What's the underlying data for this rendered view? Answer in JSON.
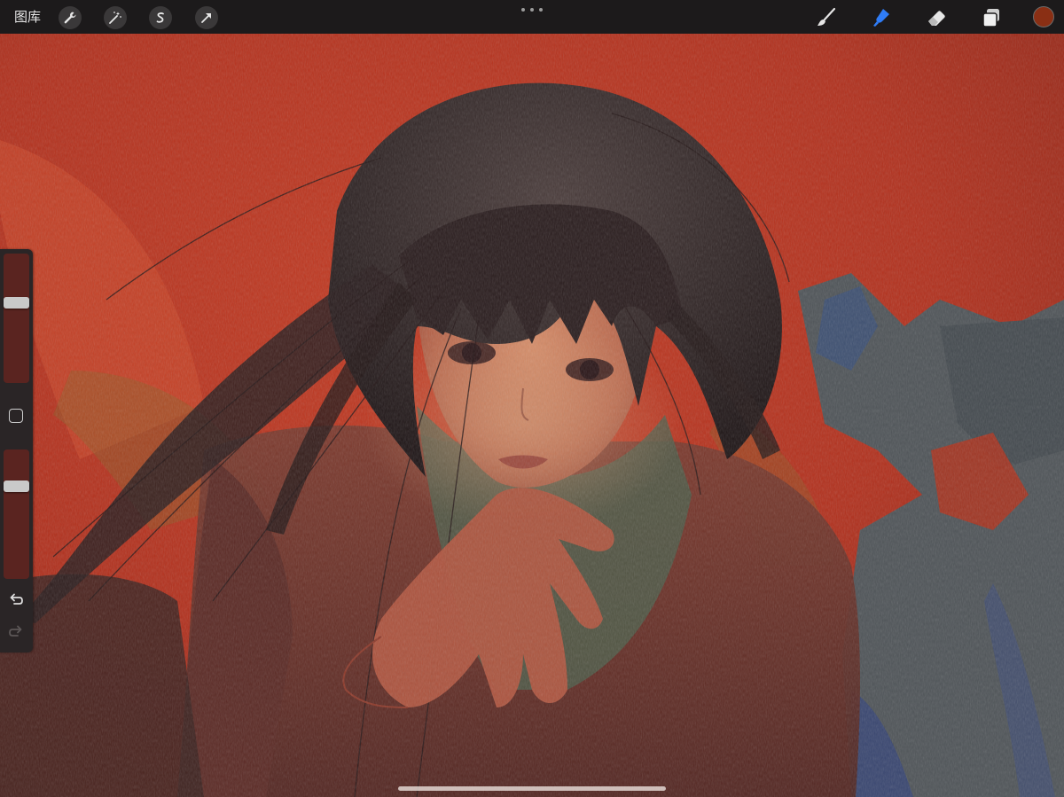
{
  "app": {
    "gallery_label": "图库"
  },
  "topbar": {
    "left_tools": [
      {
        "icon": "wrench-icon",
        "name": "actions"
      },
      {
        "icon": "magic-wand-icon",
        "name": "adjustments"
      },
      {
        "icon": "selection-s-icon",
        "name": "selection"
      },
      {
        "icon": "arrow-cursor-icon",
        "name": "transform"
      }
    ],
    "right_tools": [
      {
        "icon": "brush-icon",
        "name": "paint",
        "active": false
      },
      {
        "icon": "smudge-icon",
        "name": "smudge",
        "active": true
      },
      {
        "icon": "eraser-icon",
        "name": "erase",
        "active": false
      },
      {
        "icon": "layers-icon",
        "name": "layers",
        "active": false
      }
    ],
    "current_color": "#8a2f14",
    "accent_color": "#2f7cf6"
  },
  "sidebar": {
    "brush_size_level": 0.63,
    "opacity_level": 0.74,
    "icons": [
      "modify-square-icon",
      "undo-icon",
      "redo-icon"
    ]
  }
}
